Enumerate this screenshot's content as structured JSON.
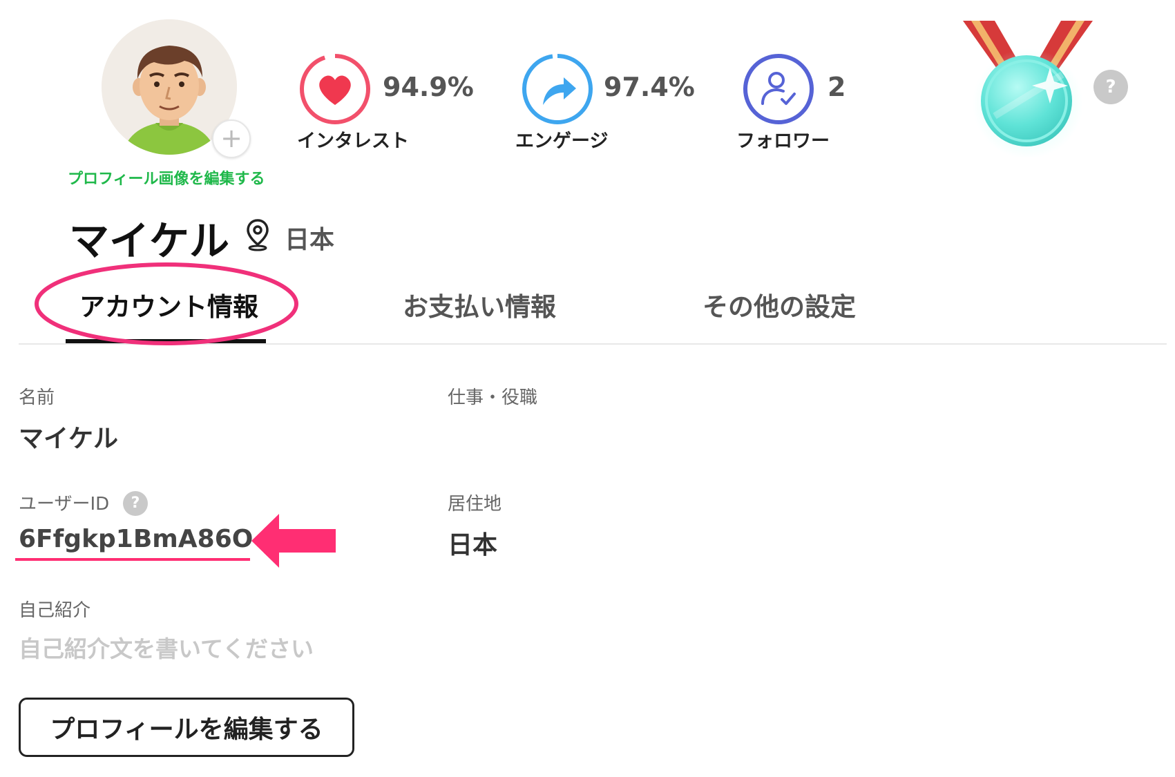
{
  "profile": {
    "edit_photo_link": "プロフィール画像を編集する",
    "name": "マイケル",
    "location": "日本"
  },
  "stats": [
    {
      "label": "インタレスト",
      "value": "94.9%",
      "icon": "heart-icon",
      "color": "#f2506b",
      "progress": 94.9
    },
    {
      "label": "エンゲージ",
      "value": "97.4%",
      "icon": "share-arrow-icon",
      "color": "#3ea6ef",
      "progress": 97.4
    },
    {
      "label": "フォロワー",
      "value": "2",
      "icon": "user-check-icon",
      "color": "#5663d6"
    }
  ],
  "medal": {
    "help": "?"
  },
  "tabs": [
    {
      "label": "アカウント情報",
      "active": true
    },
    {
      "label": "お支払い情報",
      "active": false
    },
    {
      "label": "その他の設定",
      "active": false
    }
  ],
  "fields": {
    "name": {
      "label": "名前",
      "value": "マイケル"
    },
    "job": {
      "label": "仕事・役職",
      "value": ""
    },
    "user_id": {
      "label": "ユーザーID",
      "help": "?",
      "value": "6Ffgkp1BmA86O"
    },
    "residence": {
      "label": "居住地",
      "value": "日本"
    },
    "bio": {
      "label": "自己紹介",
      "placeholder": "自己紹介文を書いてください"
    }
  },
  "edit_profile_button": "プロフィールを編集する",
  "colors": {
    "accent_green": "#1fb84a",
    "annotation_pink": "#ff2e73"
  }
}
